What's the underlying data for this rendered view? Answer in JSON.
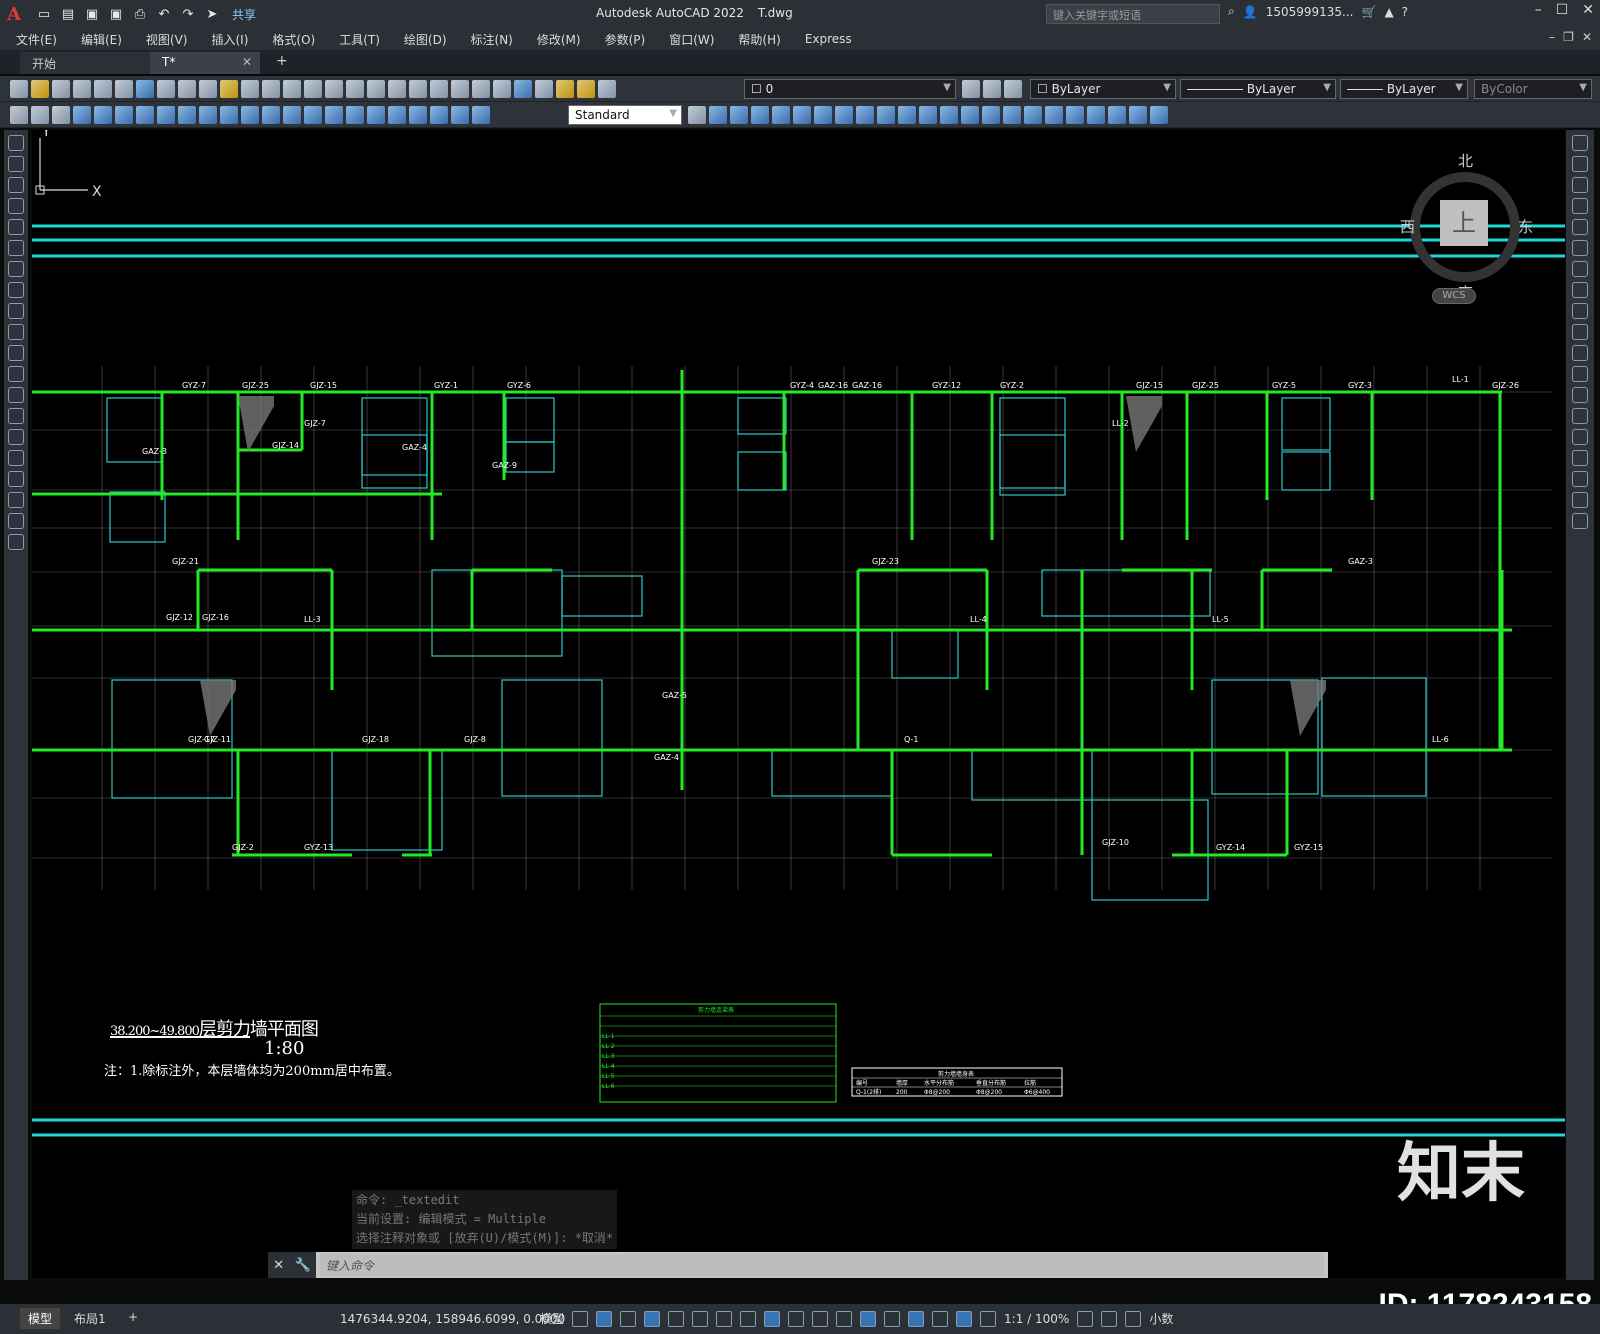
{
  "app": {
    "product": "Autodesk AutoCAD 2022",
    "file": "T.dwg",
    "share_label": "共享",
    "search_placeholder": "键入关键字或短语",
    "user": "1505999135...",
    "help": "?"
  },
  "menu": [
    "文件(E)",
    "编辑(E)",
    "视图(V)",
    "插入(I)",
    "格式(O)",
    "工具(T)",
    "绘图(D)",
    "标注(N)",
    "修改(M)",
    "参数(P)",
    "窗口(W)",
    "帮助(H)",
    "Express"
  ],
  "tabs": {
    "start": "开始",
    "active": "T*"
  },
  "toolbar": {
    "layer_value": "0",
    "color_value": "ByLayer",
    "linetype_value": "ByLayer",
    "lineweight_value": "ByLayer",
    "plotstyle_value": "ByColor",
    "textstyle_value": "Standard"
  },
  "viewcube": {
    "north": "北",
    "south": "南",
    "east": "东",
    "west": "西",
    "face": "上",
    "wcs": "WCS"
  },
  "drawing": {
    "title_prefix": "38.200~49.800",
    "title_main": "层剪力墙平面图",
    "scale": "1:80",
    "note": "注：1.除标注外，本层墙体均为200mm居中布置。",
    "labels": [
      "GYZ-7",
      "GJZ-25",
      "GJZ-15",
      "GYZ-1",
      "GYZ-6",
      "GYZ-4",
      "GAZ-16",
      "GAZ-16",
      "GYZ-12",
      "GYZ-2",
      "GJZ-15",
      "GJZ-25",
      "GYZ-5",
      "GYZ-3",
      "GJZ-26",
      "GJZ-14",
      "GAZ-3",
      "GAZ-4",
      "GAZ-9",
      "GJZ-21",
      "GJZ-12",
      "GJZ-16",
      "GJZ-23",
      "GAZ-3",
      "GJZ-17",
      "GJZ-11",
      "GJZ-18",
      "GJZ-8",
      "GAZ-5",
      "GAZ-4",
      "GJZ-2",
      "GYZ-13",
      "GJZ-10",
      "GYZ-14",
      "GYZ-15",
      "GJZ-7",
      "LL-2",
      "LL-3",
      "LL-4",
      "LL-5",
      "LL-6",
      "LL-1",
      "Q-1"
    ]
  },
  "table_lianliang": {
    "title": "剪力墙连梁表",
    "rows": [
      "LL-1",
      "LL-2",
      "LL-3",
      "LL-4",
      "LL-5",
      "LL-6"
    ]
  },
  "table_wall": {
    "title": "剪力墙墙身表",
    "headers": [
      "编号",
      "墙厚",
      "水平分布筋",
      "垂直分布筋",
      "拉筋"
    ],
    "row": [
      "Q-1(2排)",
      "200",
      "Φ8@200",
      "Φ8@200",
      "Φ6@400"
    ]
  },
  "command": {
    "history": [
      "命令: _textedit",
      "当前设置: 编辑模式 = Multiple",
      "选择注释对象或 [放弃(U)/模式(M)]: *取消*"
    ],
    "placeholder": "键入命令"
  },
  "status": {
    "model_tab": "模型",
    "layout_tab": "布局1",
    "coords": "1476344.9204, 158946.6099, 0.0000",
    "model_label": "模型",
    "scale": "1:1 / 100%",
    "units": "小数"
  },
  "watermark": {
    "logo": "知末",
    "id": "ID: 1178243158"
  },
  "colors": {
    "wall": "#27e827",
    "axis": "#ffffff",
    "grid": "#2fc7c7",
    "border": "#1fd7d7",
    "bg": "#000000"
  }
}
